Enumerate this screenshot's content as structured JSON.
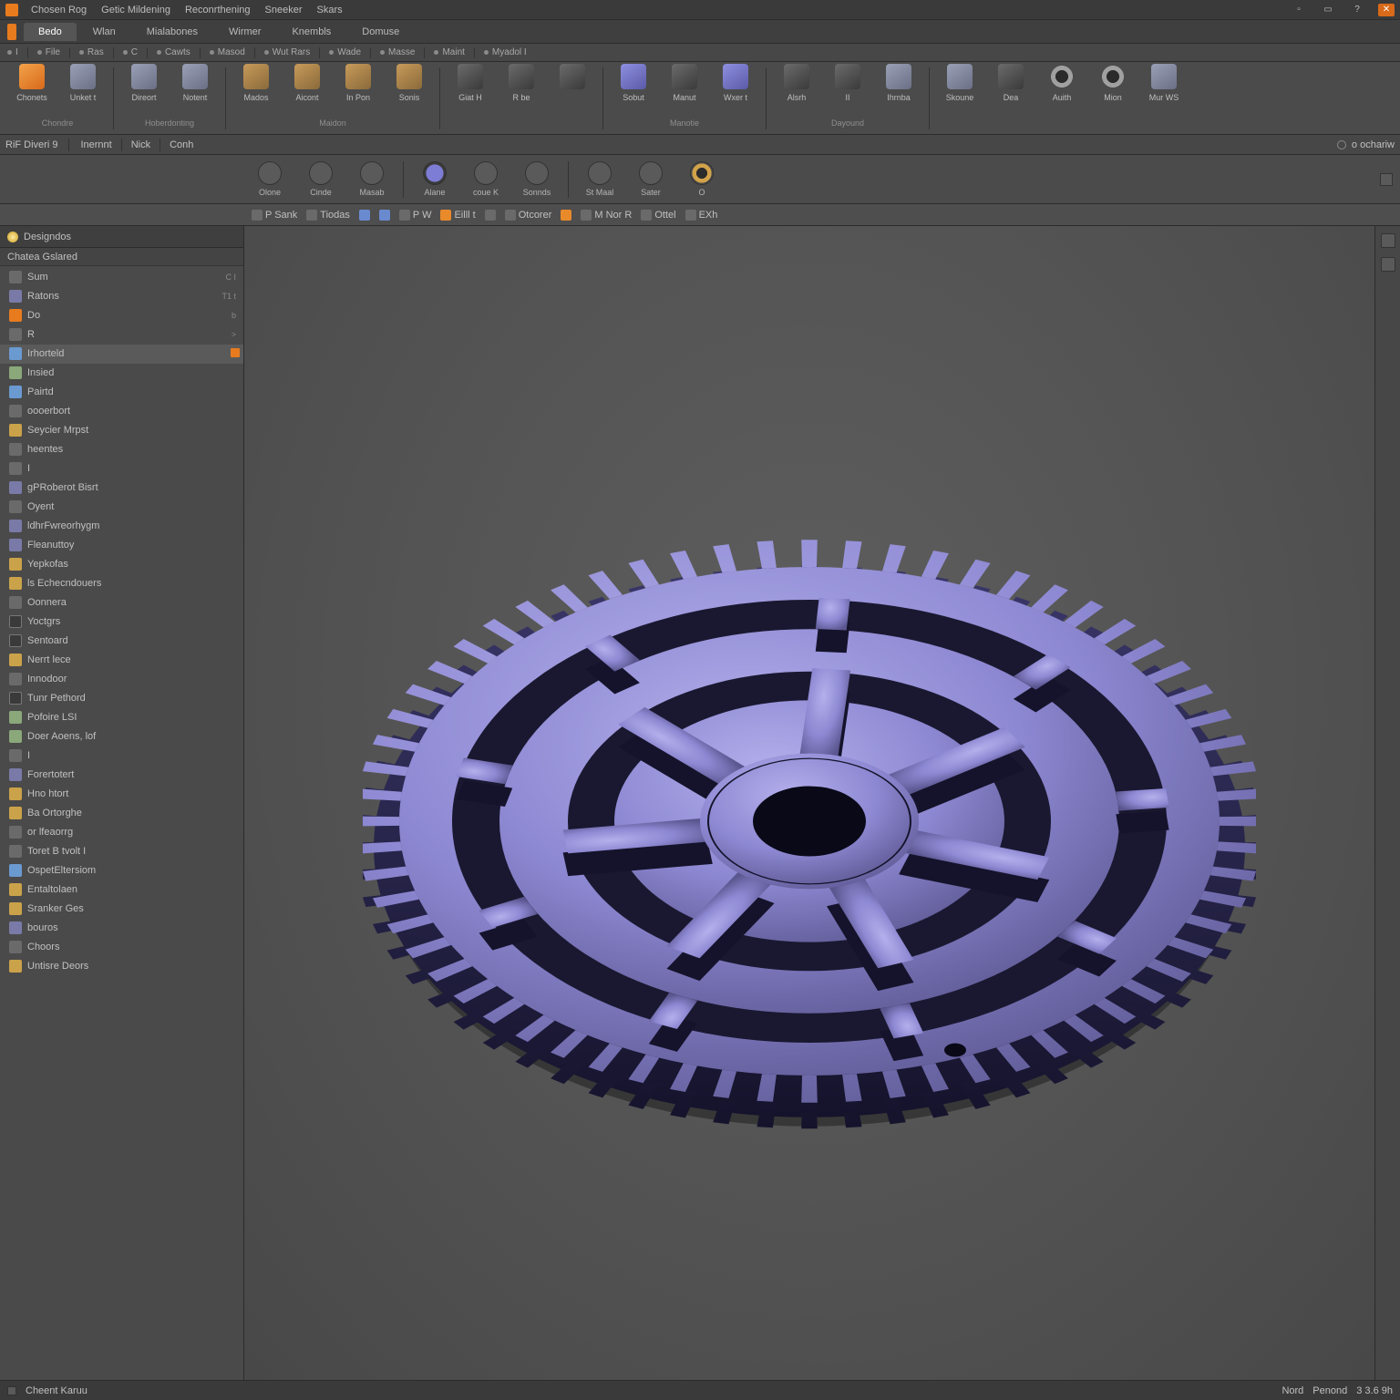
{
  "app": {
    "menus": [
      "Chosen Rog",
      "Getic Mildening",
      "Reconrthening",
      "Sneeker",
      "Skars"
    ],
    "window_icons": [
      "min",
      "max",
      "help",
      "close"
    ]
  },
  "tabs": {
    "items": [
      "Bedo",
      "Wlan",
      "Mialabones",
      "Wirmer",
      "Knembls",
      "Domuse"
    ],
    "active_index": 0
  },
  "qat": {
    "items": [
      "I",
      "File",
      "Ras",
      "C",
      "Cawts",
      "Masod",
      "Wut Rars",
      "Wade",
      "Masse",
      "Maint",
      "Myadol I"
    ]
  },
  "ribbon": {
    "groups": [
      {
        "label": "Chondre",
        "buttons": [
          {
            "label": "Chonets",
            "icon": "orange"
          },
          {
            "label": "Unket t",
            "icon": "steel"
          }
        ]
      },
      {
        "label": "Hoberdonting",
        "buttons": [
          {
            "label": "Direort",
            "icon": "steel"
          },
          {
            "label": "Notent",
            "icon": "steel"
          }
        ]
      },
      {
        "label": "Maidon",
        "buttons": [
          {
            "label": "Mados",
            "icon": "box"
          },
          {
            "label": "Aicont",
            "icon": "box"
          },
          {
            "label": "In Pon",
            "icon": "box"
          },
          {
            "label": "Sonis",
            "icon": "box"
          }
        ]
      },
      {
        "label": "",
        "buttons": [
          {
            "label": "Giat H",
            "icon": "dark"
          },
          {
            "label": "R be",
            "icon": "dark"
          },
          {
            "label": "",
            "icon": "dark"
          }
        ]
      },
      {
        "label": "Manotie",
        "buttons": [
          {
            "label": "Sobut",
            "icon": "violet"
          },
          {
            "label": "Manut",
            "icon": "dark"
          },
          {
            "label": "Wxer t",
            "icon": "violet"
          }
        ]
      },
      {
        "label": "Dayound",
        "buttons": [
          {
            "label": "Alsrh",
            "icon": "dark"
          },
          {
            "label": "II",
            "icon": "dark"
          },
          {
            "label": "Ihrnba",
            "icon": "steel"
          }
        ]
      },
      {
        "label": "",
        "buttons": [
          {
            "label": "Skoune",
            "icon": "steel"
          },
          {
            "label": "Dea",
            "icon": "dark"
          },
          {
            "label": "Auith",
            "icon": "ring"
          },
          {
            "label": "Mion",
            "icon": "ring"
          },
          {
            "label": "Mur WS",
            "icon": "steel"
          }
        ]
      }
    ]
  },
  "cmdstrip": {
    "left": [
      "RiF Diveri 9"
    ],
    "mid": [
      "Inernnt",
      "Nick",
      "Conh"
    ],
    "right": [
      "o ochariw"
    ]
  },
  "panelrow": {
    "buttons": [
      {
        "label": "Olone",
        "icon": "plain"
      },
      {
        "label": "Cinde",
        "icon": "plain"
      },
      {
        "label": "Masab",
        "icon": "plain"
      },
      {
        "label": "Alane",
        "icon": "inner"
      },
      {
        "label": "coue K",
        "icon": "plain"
      },
      {
        "label": "Sonnds",
        "icon": "plain"
      },
      {
        "label": "St Maal",
        "icon": "plain"
      },
      {
        "label": "Sater",
        "icon": "plain"
      },
      {
        "label": "O",
        "icon": "ring"
      }
    ]
  },
  "minitool": {
    "items": [
      "P Sank",
      "Tiodas",
      "",
      "",
      "P W",
      "Eilll t",
      "",
      "Otcorer",
      "",
      "M Nor R",
      "Ottel",
      "EXh"
    ]
  },
  "browser": {
    "title": "Designdos",
    "subheader": "Chatea  Gslared",
    "nodes": [
      {
        "icon": "gray",
        "label": "Sum",
        "badge": "C  I"
      },
      {
        "icon": "cube",
        "label": "Ratons",
        "badge": "T1 t"
      },
      {
        "icon": "orange",
        "label": "Do",
        "badge": "b"
      },
      {
        "icon": "gray",
        "label": "R",
        "badge": ">"
      },
      {
        "icon": "pt",
        "label": "Irhorteld",
        "badge": "",
        "selected": true,
        "marker": true
      },
      {
        "icon": "doc",
        "label": "Insied",
        "badge": ""
      },
      {
        "icon": "pt",
        "label": "Pairtd",
        "badge": ""
      },
      {
        "icon": "gray",
        "label": "oooerbort",
        "badge": ""
      },
      {
        "icon": "folder",
        "label": "Seycier Mrpst",
        "badge": ""
      },
      {
        "icon": "gray",
        "label": "heentes",
        "badge": ""
      },
      {
        "icon": "gray",
        "label": "I",
        "badge": ""
      },
      {
        "icon": "cube",
        "label": "gPRoberot Bisrt",
        "badge": ""
      },
      {
        "icon": "gray",
        "label": "Oyent",
        "badge": ""
      },
      {
        "icon": "cube",
        "label": "ldhrFwreorhygm",
        "badge": ""
      },
      {
        "icon": "cube",
        "label": "Fleanuttoy",
        "badge": ""
      },
      {
        "icon": "folder",
        "label": "Yepkofas",
        "badge": ""
      },
      {
        "icon": "folder",
        "label": "ls Echecndouers",
        "badge": ""
      },
      {
        "icon": "gray",
        "label": "Oonnera",
        "badge": ""
      },
      {
        "icon": "dot",
        "label": "Yoctgrs",
        "badge": ""
      },
      {
        "icon": "dot",
        "label": "Sentoard",
        "badge": ""
      },
      {
        "icon": "folder",
        "label": "Nerrt  lece",
        "badge": ""
      },
      {
        "icon": "gray",
        "label": "Innodoor",
        "badge": ""
      },
      {
        "icon": "dot",
        "label": "Tunr Pethord",
        "badge": ""
      },
      {
        "icon": "doc",
        "label": "Pofoire LSI",
        "badge": ""
      },
      {
        "icon": "doc",
        "label": "Doer Aoens, lof",
        "badge": ""
      },
      {
        "icon": "gray",
        "label": "I",
        "badge": ""
      },
      {
        "icon": "cube",
        "label": "Forertotert",
        "badge": ""
      },
      {
        "icon": "folder",
        "label": "Hno htort",
        "badge": ""
      },
      {
        "icon": "folder",
        "label": "Ba Ortorghe",
        "badge": ""
      },
      {
        "icon": "gray",
        "label": "or lfeaorrg",
        "badge": ""
      },
      {
        "icon": "gray",
        "label": "Toret B tvolt I",
        "badge": ""
      },
      {
        "icon": "pt",
        "label": "OspetEltersiom",
        "badge": ""
      },
      {
        "icon": "folder",
        "label": "Entaltolaen",
        "badge": ""
      },
      {
        "icon": "folder",
        "label": "Sranker Ges",
        "badge": ""
      },
      {
        "icon": "cube",
        "label": "bouros",
        "badge": ""
      },
      {
        "icon": "gray",
        "label": "Choors",
        "badge": ""
      },
      {
        "icon": "folder",
        "label": "Untisre Deors",
        "badge": ""
      }
    ]
  },
  "status": {
    "left": "Cheent Karuu",
    "right": [
      "Nord",
      "Penond",
      "3 3.6 9h"
    ]
  },
  "colors": {
    "accent": "#e87b1e",
    "gear_light": "#9a96d8",
    "gear_dark": "#4a4680"
  }
}
